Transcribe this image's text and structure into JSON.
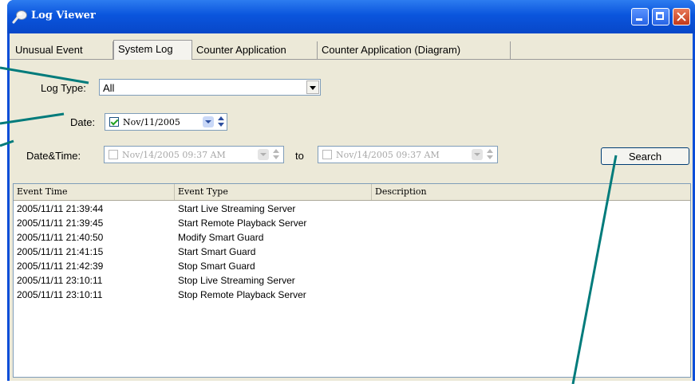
{
  "window": {
    "title": "Log Viewer"
  },
  "tabs": [
    "Unusual Event",
    "System Log",
    "Counter Application",
    "Counter Application (Diagram)"
  ],
  "active_tab": "System Log",
  "filters": {
    "log_type_label": "Log Type:",
    "log_type_value": "All",
    "date_label": "Date:",
    "date_value": "Nov/11/2005",
    "date_checked": true,
    "datetime_label": "Date&Time:",
    "datetime_from": "Nov/14/2005 09:37 AM",
    "datetime_to_label": "to",
    "datetime_to": "Nov/14/2005 09:37 AM",
    "datetime_enabled": false
  },
  "search_label": "Search",
  "list": {
    "columns": [
      "Event Time",
      "Event Type",
      "Description"
    ],
    "rows": [
      {
        "time": "2005/11/11 21:39:44",
        "type": "Start Live Streaming Server",
        "description": ""
      },
      {
        "time": "2005/11/11 21:39:45",
        "type": "Start Remote Playback Server",
        "description": ""
      },
      {
        "time": "2005/11/11 21:40:50",
        "type": "Modify Smart Guard",
        "description": ""
      },
      {
        "time": "2005/11/11 21:41:15",
        "type": "Start Smart Guard",
        "description": ""
      },
      {
        "time": "2005/11/11 21:42:39",
        "type": "Stop Smart Guard",
        "description": ""
      },
      {
        "time": "2005/11/11 23:10:11",
        "type": "Stop Live Streaming Server",
        "description": ""
      },
      {
        "time": "2005/11/11 23:10:11",
        "type": "Stop Remote Playback Server",
        "description": ""
      }
    ]
  },
  "colors": {
    "title_bar": "#0a55dd",
    "callout_line": "#007b7b",
    "window_face": "#ece9d8"
  }
}
